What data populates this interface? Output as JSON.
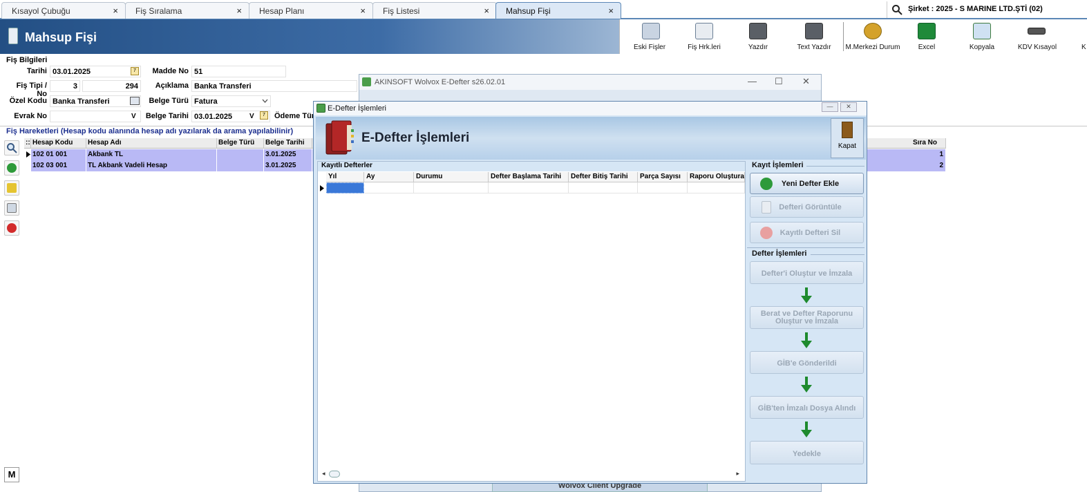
{
  "tabs": [
    {
      "label": "Kısayol Çubuğu"
    },
    {
      "label": "Fiş Sıralama"
    },
    {
      "label": "Hesap Planı"
    },
    {
      "label": "Fiş Listesi"
    },
    {
      "label": "Mahsup Fişi"
    }
  ],
  "tab_close": "×",
  "company": "Şirket : 2025 - S MARINE LTD.ŞTİ (02)",
  "page_title": "Mahsup Fişi",
  "toolbar": [
    {
      "label": "Eski Fişler",
      "icon": "old-receipts-icon"
    },
    {
      "label": "Fiş Hrk.leri",
      "icon": "receipt-movements-icon"
    },
    {
      "label": "Yazdır",
      "icon": "printer-icon"
    },
    {
      "label": "Text Yazdır",
      "icon": "text-printer-icon"
    },
    {
      "label": "M.Merkezi Durum",
      "icon": "coins-icon"
    },
    {
      "label": "Excel",
      "icon": "excel-icon"
    },
    {
      "label": "Kopyala",
      "icon": "copy-icon"
    },
    {
      "label": "KDV Kısayol",
      "icon": "keyboard-icon"
    },
    {
      "label": "K",
      "icon": "more-icon"
    }
  ],
  "fis_bilgileri": {
    "title": "Fiş Bilgileri",
    "tarihi_label": "Tarihi",
    "tarihi": "03.01.2025",
    "madde_no_label": "Madde No",
    "madde_no": "51",
    "fis_tipi_label": "Fiş Tipi / No",
    "fis_tipi": "3",
    "fis_no": "294",
    "aciklama_label": "Açıklama",
    "aciklama": "Banka Transferi",
    "ozel_kodu_label": "Özel Kodu",
    "ozel_kodu": "Banka Transferi",
    "belge_turu_label": "Belge Türü",
    "belge_turu": "Fatura",
    "evrak_no_label": "Evrak No",
    "evrak_no": "",
    "belge_tarihi_label": "Belge Tarihi",
    "belge_tarihi": "03.01.2025",
    "odeme_turu_label": "Ödeme Tür",
    "v_label": "V",
    "cal_label": "7"
  },
  "fis_hareketleri": {
    "title": "Fiş Hareketleri (Hesap kodu alanında hesap adı yazılarak da arama yapılabilinir)",
    "columns": [
      "Hesap Kodu",
      "Hesap Adı",
      "Belge Türü",
      "Belge Tarihi",
      "Sıra No"
    ],
    "rows": [
      {
        "hesap_kodu": "102 01 001",
        "hesap_adi": "Akbank TL",
        "belge_turu": "",
        "belge_tarihi": "3.01.2025",
        "sira_no": "1"
      },
      {
        "hesap_kodu": "102 03 001",
        "hesap_adi": "TL Akbank Vadeli Hesap",
        "belge_turu": "",
        "belge_tarihi": "3.01.2025",
        "sira_no": "2"
      }
    ]
  },
  "left_bar": [
    "search-icon",
    "add-icon",
    "edit-icon",
    "copy-icon",
    "delete-icon"
  ],
  "m_button": "M",
  "bg_window": {
    "title": "AKINSOFT Wolvox E-Defter s26.02.01",
    "upgrade": "Wolvox Client Upgrade",
    "minimize": "—",
    "maximize": "☐",
    "close": "✕"
  },
  "dialog": {
    "title": "E-Defter İşlemleri",
    "banner_title": "E-Defter İşlemleri",
    "kapat": "Kapat",
    "ctl_min": "—",
    "ctl_close": "✕",
    "kayitli_defterler": "Kayıtlı Defterler",
    "columns": [
      "Yıl",
      "Ay",
      "Durumu",
      "Defter Başlama Tarihi",
      "Defter Bitiş Tarihi",
      "Parça Sayısı",
      "Raporu Oluştura"
    ],
    "scroll_left": "◂",
    "scroll_right": "▸",
    "kayit_islemleri": "Kayıt İşlemleri",
    "btn_yeni": "Yeni Defter Ekle",
    "btn_goruntule": "Defteri Görüntüle",
    "btn_sil": "Kayıtlı Defteri Sil",
    "defter_islemleri": "Defter İşlemleri",
    "btn_olustur": "Defter'i Oluştur ve İmzala",
    "btn_berat_1": "Berat ve Defter Raporunu",
    "btn_berat_2": "Oluştur ve İmzala",
    "btn_gib": "GİB'e Gönderildi",
    "btn_gibten": "GİB'ten İmzalı Dosya Alındı",
    "btn_yedekle": "Yedekle"
  }
}
